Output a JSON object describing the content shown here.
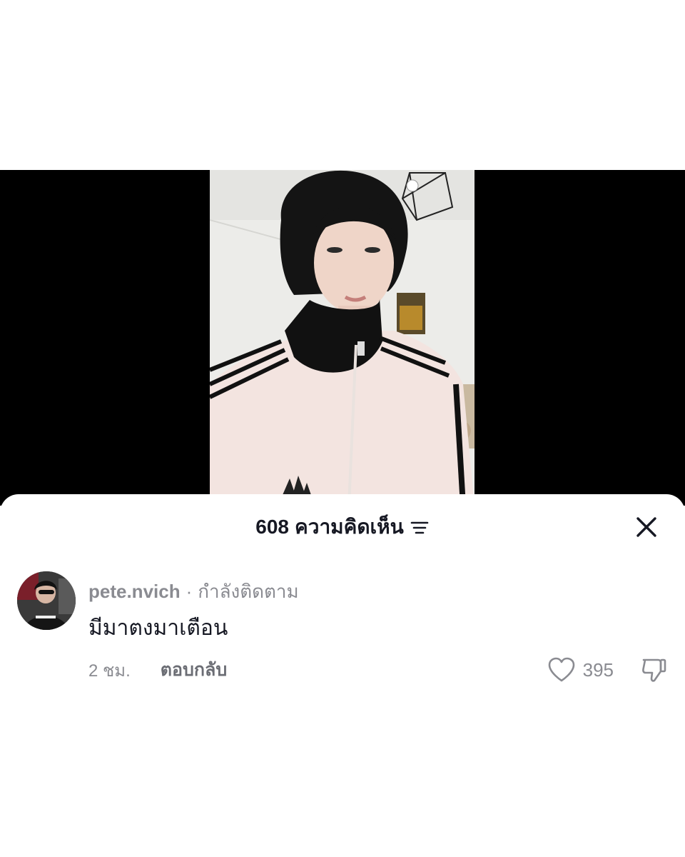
{
  "sheet": {
    "count": "608",
    "title": "ความคิดเห็น"
  },
  "comment": {
    "username": "pete.nvich",
    "separator": "·",
    "status": "กำลังติดตาม",
    "text": "มีมาตงมาเตือน",
    "time": "2 ชม.",
    "reply_label": "ตอบกลับ",
    "likes": "395"
  },
  "icons": {
    "filter": "filter-icon",
    "close": "close-icon",
    "like": "heart-icon",
    "dislike": "thumbs-down-icon"
  }
}
